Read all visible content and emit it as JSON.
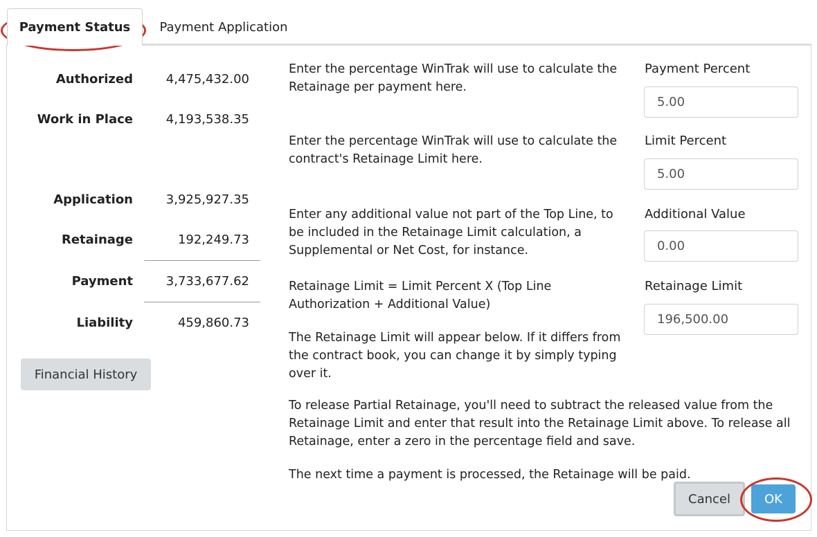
{
  "tabs": [
    {
      "label": "Payment Status",
      "active": true
    },
    {
      "label": "Payment Application",
      "active": false
    }
  ],
  "summary": {
    "rows": [
      {
        "label": "Authorized",
        "value": "4,475,432.00"
      },
      {
        "label": "Work in Place",
        "value": "4,193,538.35"
      },
      {
        "label": "Application",
        "value": "3,925,927.35"
      },
      {
        "label": "Retainage",
        "value": "192,249.73"
      },
      {
        "label": "Payment",
        "value": "3,733,677.62"
      },
      {
        "label": "Liability",
        "value": "459,860.73"
      }
    ],
    "financial_history_label": "Financial History"
  },
  "instructions": {
    "payment_percent": "Enter the percentage WinTrak will use to calculate the Retainage per payment here.",
    "limit_percent": "Enter the percentage WinTrak will use to calculate the contract's Retainage Limit here.",
    "additional_value": "Enter any additional value not part of the Top Line, to be included in the Retainage Limit calculation, a Supplemental or Net Cost, for instance.",
    "formula": "Retainage Limit = Limit Percent X (Top Line Authorization + Additional Value)",
    "appear_below": "The Retainage Limit will appear below. If it differs from the contract book, you can change it by simply typing over it.",
    "partial_release": "To release Partial Retainage, you'll need to subtract the released value from the Retainage Limit and enter that result into the Retainage Limit above. To release all Retainage, enter a zero in the percentage field and save.",
    "next_time": "The next time a payment is processed, the Retainage will be paid."
  },
  "fields": {
    "payment_percent": {
      "label": "Payment Percent",
      "value": "5.00"
    },
    "limit_percent": {
      "label": "Limit Percent",
      "value": "5.00"
    },
    "additional_value": {
      "label": "Additional Value",
      "value": "0.00"
    },
    "retainage_limit": {
      "label": "Retainage Limit",
      "value": "196,500.00"
    }
  },
  "buttons": {
    "cancel_label": "Cancel",
    "ok_label": "OK"
  },
  "colors": {
    "highlight": "#c8372a",
    "ok_button": "#4da3d9",
    "neutral_button": "#d9dde0"
  }
}
